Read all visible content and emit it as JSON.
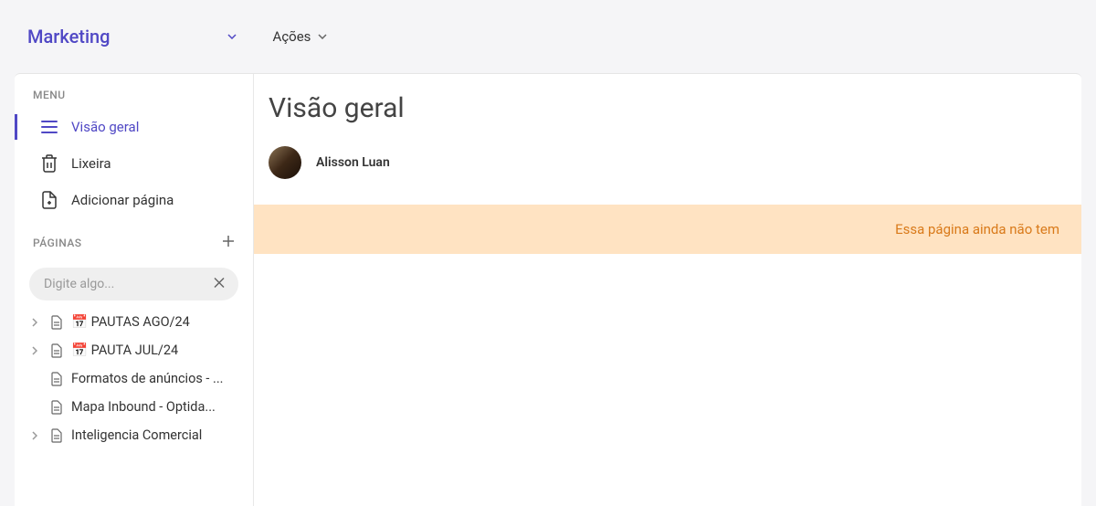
{
  "header": {
    "title": "Marketing",
    "actions_label": "Ações"
  },
  "sidebar": {
    "menu_label": "MENU",
    "items": [
      {
        "label": "Visão geral",
        "icon": "list",
        "active": true
      },
      {
        "label": "Lixeira",
        "icon": "trash",
        "active": false
      },
      {
        "label": "Adicionar página",
        "icon": "add-page",
        "active": false
      }
    ],
    "pages_label": "PÁGINAS",
    "search_placeholder": "Digite algo...",
    "pages": [
      {
        "label": "📅 PAUTAS AGO/24",
        "expandable": true
      },
      {
        "label": "📅 PAUTA JUL/24",
        "expandable": true
      },
      {
        "label": "Formatos de anúncios - ...",
        "expandable": false
      },
      {
        "label": "Mapa Inbound - Optida...",
        "expandable": false
      },
      {
        "label": "Inteligencia Comercial",
        "expandable": true
      }
    ]
  },
  "main": {
    "title": "Visão geral",
    "author": "Alisson Luan",
    "banner_text": "Essa página ainda não tem"
  }
}
